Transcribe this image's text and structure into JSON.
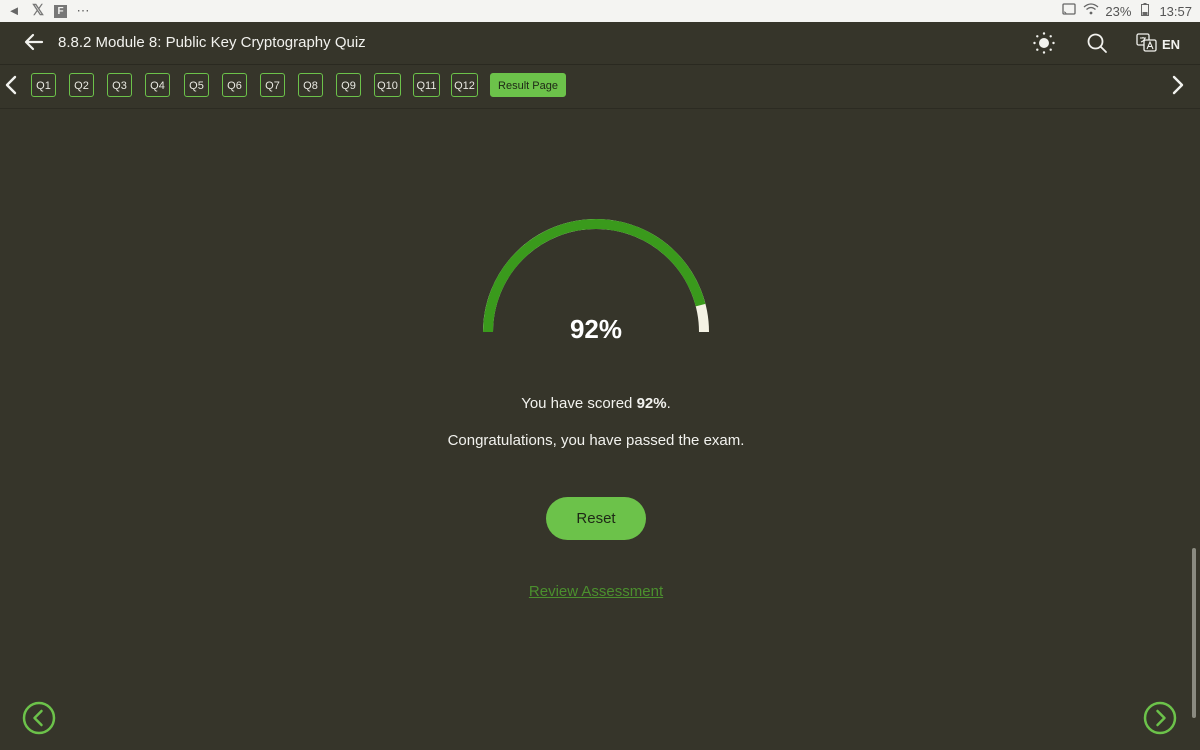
{
  "status_bar": {
    "battery": "23%",
    "time": "13:57",
    "left_icons": [
      "telegram-icon",
      "x-icon",
      "flipboard-icon",
      "more-icon"
    ],
    "right_icons": [
      "cast-icon",
      "wifi-icon",
      "battery-icon"
    ]
  },
  "header": {
    "title": "8.8.2 Module 8: Public Key Cryptography Quiz",
    "language": "EN"
  },
  "question_nav": {
    "items": [
      "Q1",
      "Q2",
      "Q3",
      "Q4",
      "Q5",
      "Q6",
      "Q7",
      "Q8",
      "Q9",
      "Q10",
      "Q11",
      "Q12"
    ],
    "result_label": "Result Page"
  },
  "result": {
    "score_value": 92,
    "score_display": "92%",
    "score_prefix": "You have scored ",
    "score_bold": "92%",
    "score_suffix": ".",
    "message": "Congratulations, you have passed the exam.",
    "reset_label": "Reset",
    "review_label": "Review Assessment"
  },
  "colors": {
    "background": "#36352a",
    "accent": "#6cc24a",
    "gauge_fill": "#3a9a1c",
    "gauge_track": "#f4f2e4",
    "link": "#4b8f2e"
  }
}
